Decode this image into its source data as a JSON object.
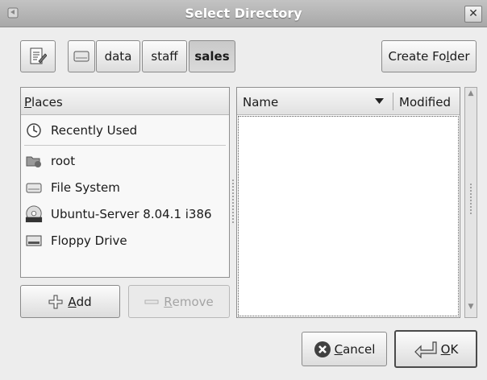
{
  "window": {
    "title": "Select Directory",
    "close_glyph": "✕"
  },
  "pathbar": {
    "segments": [
      "data",
      "staff",
      "sales"
    ],
    "active_segment": "sales"
  },
  "create_folder": {
    "pre": "Create Fo",
    "mnemonic": "l",
    "post": "der"
  },
  "places": {
    "header_mnemonic": "P",
    "header_rest": "laces",
    "items": [
      {
        "label": "Recently Used",
        "icon": "recent-icon"
      },
      {
        "label": "root",
        "icon": "home-folder-icon"
      },
      {
        "label": "File System",
        "icon": "drive-icon"
      },
      {
        "label": "Ubuntu-Server 8.04.1 i386",
        "icon": "cdrom-icon"
      },
      {
        "label": "Floppy Drive",
        "icon": "floppy-icon"
      }
    ]
  },
  "add_button": {
    "mnemonic": "A",
    "rest": "dd"
  },
  "remove_button": {
    "mnemonic": "R",
    "rest": "emove"
  },
  "files": {
    "col_name": "Name",
    "col_modified": "Modified"
  },
  "cancel_button": {
    "mnemonic": "C",
    "rest": "ancel"
  },
  "ok_button": {
    "mnemonic": "O",
    "rest": "K"
  }
}
